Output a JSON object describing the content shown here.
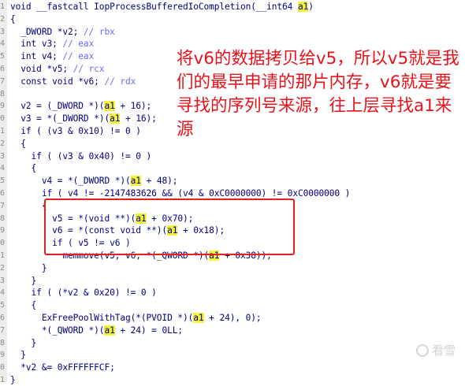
{
  "editor": {
    "lines": [
      {
        "num": "1",
        "parts": [
          [
            "k",
            "void __fastcall IopProcessBufferedIoCompletion(__int64 "
          ],
          [
            "hl",
            "a1"
          ],
          [
            "k",
            ")"
          ]
        ]
      },
      {
        "num": "2",
        "parts": [
          [
            "k",
            "{"
          ]
        ]
      },
      {
        "num": "3",
        "parts": [
          [
            "k",
            "  _DWORD *v2; "
          ],
          [
            "c",
            "// rbx"
          ]
        ]
      },
      {
        "num": "4",
        "parts": [
          [
            "k",
            "  int v3; "
          ],
          [
            "c",
            "// eax"
          ]
        ]
      },
      {
        "num": "5",
        "parts": [
          [
            "k",
            "  int v4; "
          ],
          [
            "c",
            "// eax"
          ]
        ]
      },
      {
        "num": "6",
        "parts": [
          [
            "k",
            "  void *v5; "
          ],
          [
            "c",
            "// rcx"
          ]
        ]
      },
      {
        "num": "7",
        "parts": [
          [
            "k",
            "  const void *v6; "
          ],
          [
            "c",
            "// rdx"
          ]
        ]
      },
      {
        "num": "8",
        "parts": [
          [
            "k",
            ""
          ]
        ]
      },
      {
        "num": "9",
        "parts": [
          [
            "k",
            "  v2 = (_DWORD *)("
          ],
          [
            "hl",
            "a1"
          ],
          [
            "k",
            " + 16);"
          ]
        ]
      },
      {
        "num": "0",
        "parts": [
          [
            "k",
            "  v3 = *(_DWORD *)("
          ],
          [
            "hl",
            "a1"
          ],
          [
            "k",
            " + 16);"
          ]
        ]
      },
      {
        "num": "1",
        "parts": [
          [
            "k",
            "  if ( (v3 & 0x10) != 0 )"
          ]
        ]
      },
      {
        "num": "2",
        "parts": [
          [
            "k",
            "  {"
          ]
        ]
      },
      {
        "num": "3",
        "parts": [
          [
            "k",
            "    if ( (v3 & 0x40) != 0 )"
          ]
        ]
      },
      {
        "num": "4",
        "parts": [
          [
            "k",
            "    {"
          ]
        ]
      },
      {
        "num": "5",
        "parts": [
          [
            "k",
            "      v4 = *(_DWORD *)("
          ],
          [
            "hl",
            "a1"
          ],
          [
            "k",
            " + 48);"
          ]
        ]
      },
      {
        "num": "6",
        "parts": [
          [
            "k",
            "      if ( v4 != -2147483626 && (v4 & 0xC0000000) != 0xC0000000 )"
          ]
        ]
      },
      {
        "num": "7",
        "parts": [
          [
            "k",
            "      {"
          ]
        ]
      },
      {
        "num": "8",
        "parts": [
          [
            "k",
            "        v5 = *(void **)("
          ],
          [
            "hl",
            "a1"
          ],
          [
            "k",
            " + 0x70);"
          ]
        ]
      },
      {
        "num": "9",
        "parts": [
          [
            "k",
            "        v6 = *(const void **)("
          ],
          [
            "hl",
            "a1"
          ],
          [
            "k",
            " + 0x18);"
          ]
        ]
      },
      {
        "num": "0",
        "parts": [
          [
            "k",
            "        if ( v5 != v6 )"
          ]
        ]
      },
      {
        "num": "1",
        "parts": [
          [
            "k",
            "          memmove(v5, v6, *(_QWORD *)("
          ],
          [
            "hl",
            "a1"
          ],
          [
            "k",
            " + 0x38));"
          ]
        ]
      },
      {
        "num": "2",
        "parts": [
          [
            "k",
            "      }"
          ]
        ]
      },
      {
        "num": "3",
        "parts": [
          [
            "k",
            "    }"
          ]
        ]
      },
      {
        "num": "4",
        "parts": [
          [
            "k",
            "    if ( (*v2 & 0x20) != 0 )"
          ]
        ]
      },
      {
        "num": "5",
        "parts": [
          [
            "k",
            "    {"
          ]
        ]
      },
      {
        "num": "6",
        "parts": [
          [
            "k",
            "      ExFreePoolWithTag(*(PVOID *)("
          ],
          [
            "hl",
            "a1"
          ],
          [
            "k",
            " + 24), 0);"
          ]
        ]
      },
      {
        "num": "7",
        "parts": [
          [
            "k",
            "      *(_QWORD *)("
          ],
          [
            "hl",
            "a1"
          ],
          [
            "k",
            " + 24) = 0LL;"
          ]
        ]
      },
      {
        "num": "8",
        "parts": [
          [
            "k",
            "    }"
          ]
        ]
      },
      {
        "num": "9",
        "parts": [
          [
            "k",
            "  }"
          ]
        ]
      },
      {
        "num": "0",
        "parts": [
          [
            "k",
            "  *v2 &= 0xFFFFFFCF;"
          ]
        ]
      },
      {
        "num": "1",
        "parts": [
          [
            "k",
            "}"
          ]
        ]
      }
    ]
  },
  "annotation": {
    "text": "将v6的数据拷贝给v5，所以v5就是我们的最早申请的那片内存，v6就是要寻找的序列号来源，往上层寻找a1来源"
  },
  "watermark": {
    "text": "看雪"
  },
  "colors": {
    "code": "#000080",
    "comment": "#6a6aff",
    "highlight": "#f2f23a",
    "annotation": "#e8121a",
    "box": "#e52020"
  }
}
